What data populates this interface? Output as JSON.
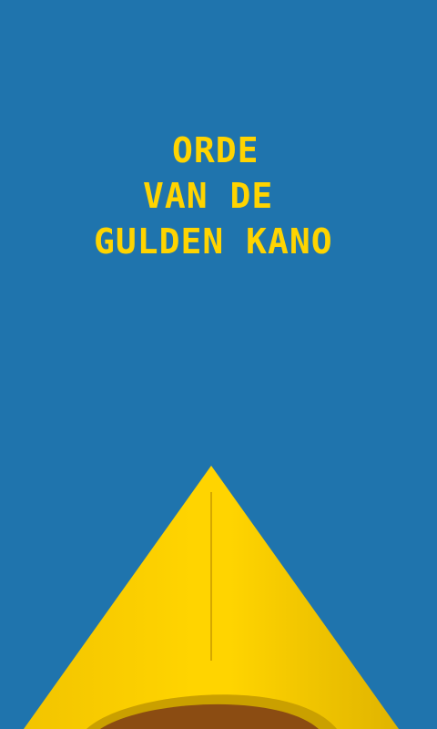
{
  "screen": {
    "background_color": "#1f74ad",
    "accent_color": "#ffd400",
    "title_lines": [
      "ORDE",
      "VAN DE",
      "GULDEN KANO"
    ]
  },
  "canoe": {
    "icon": "canoe-bow-icon",
    "hull_color": "#ffd400",
    "hull_shadow_color": "#e6b800",
    "interior_color": "#8b4c12"
  }
}
